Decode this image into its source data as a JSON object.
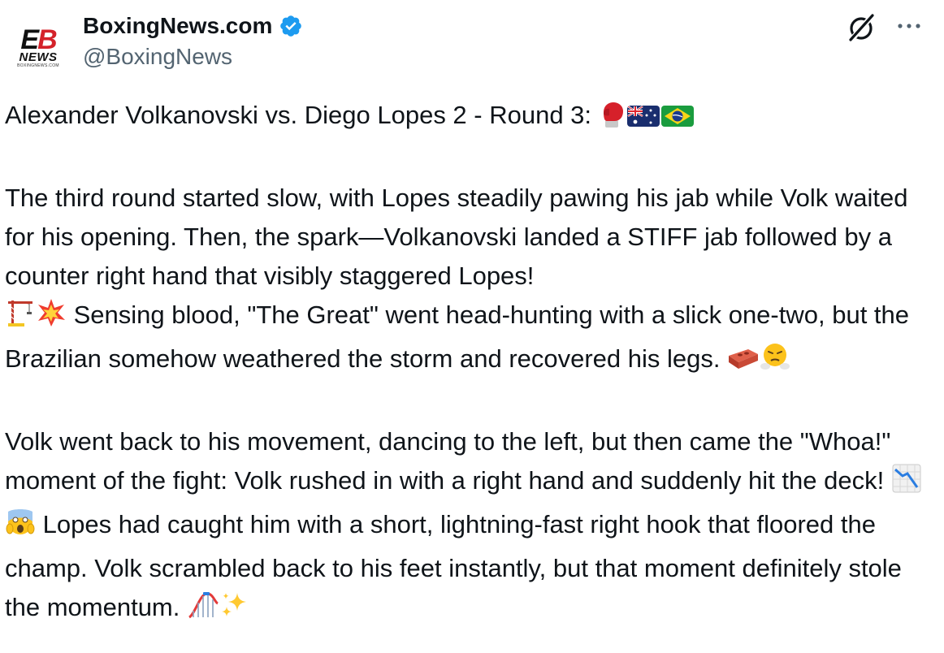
{
  "author": {
    "display_name": "BoxingNews.com",
    "handle": "@BoxingNews",
    "avatar_logo": {
      "mark_prefix": "E",
      "mark_suffix": "B",
      "word": "NEWS",
      "site": "BOXINGNEWS.COM"
    },
    "verified_icon": "verified-badge-icon",
    "brand_color": "#1d9bf0"
  },
  "actions": {
    "grok_icon": "grok-icon",
    "more_icon": "more-options-icon"
  },
  "tweet": {
    "p1_text": "Alexander Volkanovski vs. Diego Lopes 2 - Round 3:",
    "p2_text_a": "The third round started slow, with Lopes steadily pawing his jab while Volk waited for his opening. Then, the spark—Volkanovski landed a STIFF jab followed by a counter right hand that visibly staggered Lopes!",
    "p2_text_b": "Sensing blood, \"The Great\" went head-hunting with a slick one-two, but the Brazilian somehow weathered the storm and recovered his legs.",
    "p3_text_a": "Volk went back to his movement, dancing to the left, but then came the \"Whoa!\" moment of the fight: Volk rushed in with a right hand and suddenly hit the deck!",
    "p3_text_b": "Lopes had caught him with a short, lightning-fast right hook that floored the champ. Volk scrambled back to his feet instantly, but that moment definitely stole the momentum."
  },
  "emojis": [
    "boxing-glove",
    "flag-australia",
    "flag-brazil",
    "construction-crane",
    "collision",
    "brick",
    "face-with-steam",
    "chart-decreasing",
    "face-screaming",
    "roller-coaster",
    "sparkles"
  ]
}
